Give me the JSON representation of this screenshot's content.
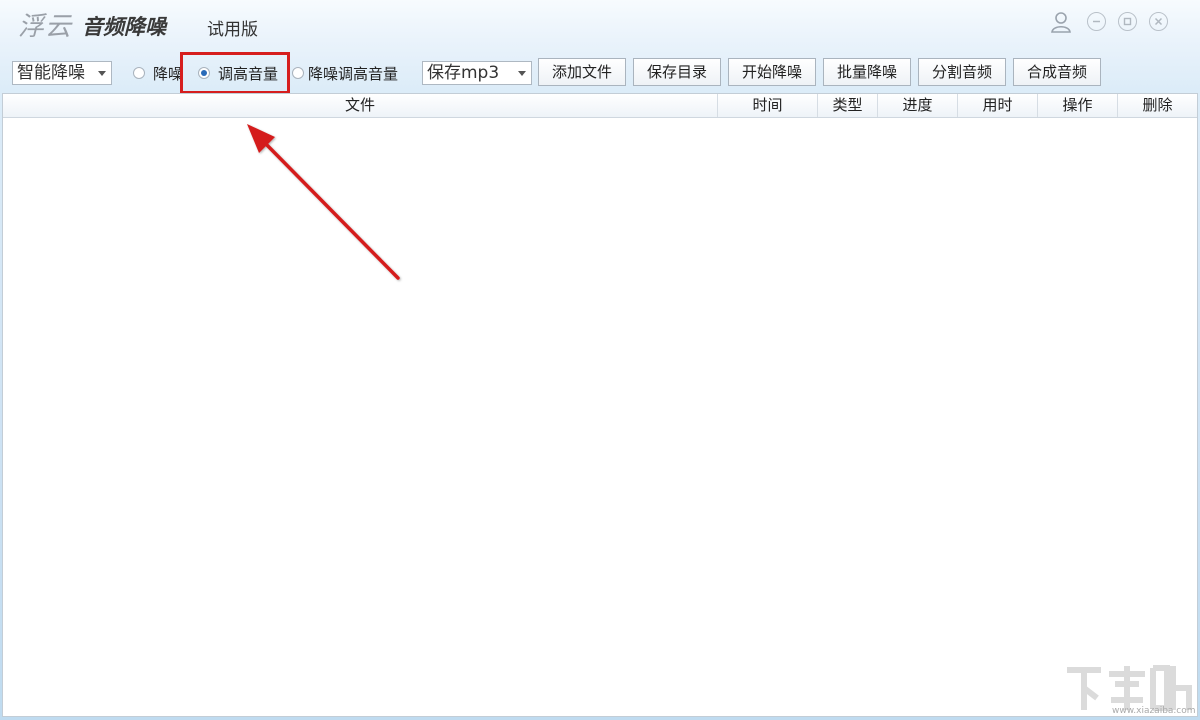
{
  "titlebar": {
    "brand_script": "浮云",
    "app_name": "音频降噪",
    "edition": "试用版"
  },
  "toolbar": {
    "mode_select": "智能降噪",
    "radios": [
      {
        "label": "降噪",
        "selected": false
      },
      {
        "label": "调高音量",
        "selected": true
      },
      {
        "label": "降噪调高音量",
        "selected": false
      }
    ],
    "format_select": "保存mp3",
    "buttons": {
      "add_file": "添加文件",
      "save_dir": "保存目录",
      "start_denoise": "开始降噪",
      "batch_denoise": "批量降噪",
      "split_audio": "分割音频",
      "merge_audio": "合成音频"
    }
  },
  "table": {
    "columns": [
      "文件",
      "时间",
      "类型",
      "进度",
      "用时",
      "操作",
      "删除"
    ],
    "rows": []
  },
  "annotation": {
    "highlight_color": "#d61e1e"
  },
  "watermark": {
    "logo_text": "下载吧",
    "url": "www.xiazaiba.com"
  }
}
